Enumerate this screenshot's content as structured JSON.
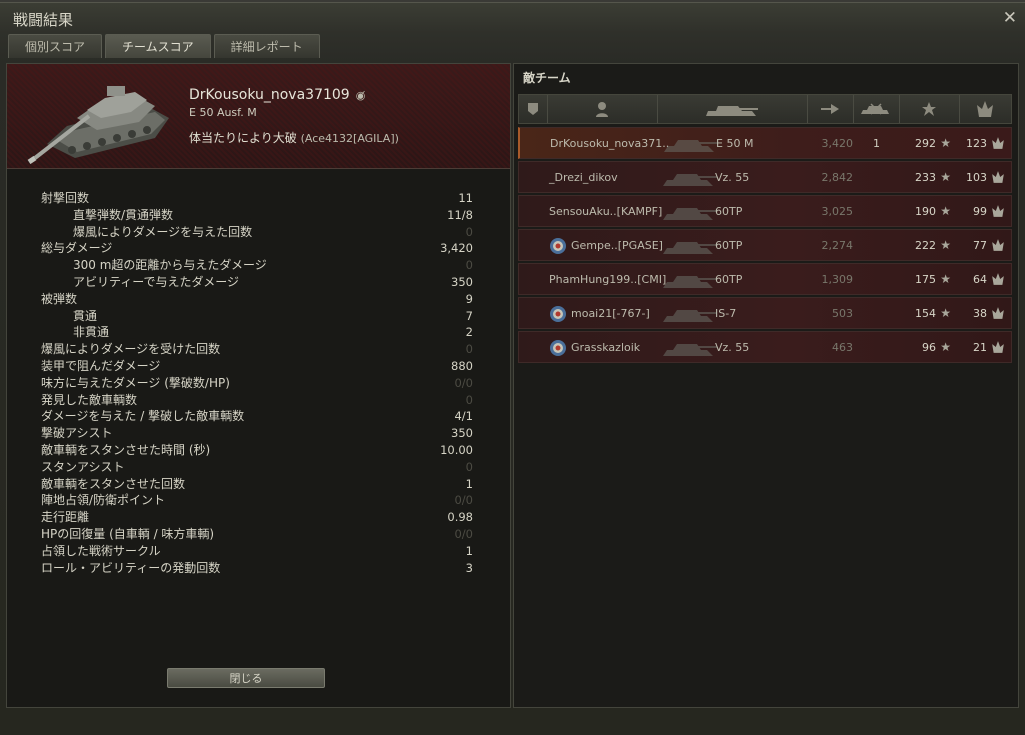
{
  "window": {
    "title": "戦闘結果"
  },
  "tabs": [
    {
      "label": "個別スコア",
      "active": false
    },
    {
      "label": "チームスコア",
      "active": true
    },
    {
      "label": "詳細レポート",
      "active": false
    }
  ],
  "player": {
    "name": "DrKousoku_nova37109",
    "tank": "E 50 Ausf. M",
    "status": "体当たりにより大破",
    "killer": "(Ace4132[AGILA])"
  },
  "stats": [
    {
      "label": "射撃回数",
      "value": "11",
      "indent": false,
      "zero": false
    },
    {
      "label": "直撃弾数/貫通弾数",
      "value": "11/8",
      "indent": true,
      "zero": false
    },
    {
      "label": "爆風によりダメージを与えた回数",
      "value": "0",
      "indent": true,
      "zero": true
    },
    {
      "label": "総与ダメージ",
      "value": "3,420",
      "indent": false,
      "zero": false
    },
    {
      "label": "300 m超の距離から与えたダメージ",
      "value": "0",
      "indent": true,
      "zero": true
    },
    {
      "label": "アビリティーで与えたダメージ",
      "value": "350",
      "indent": true,
      "zero": false
    },
    {
      "label": "被弾数",
      "value": "9",
      "indent": false,
      "zero": false
    },
    {
      "label": "貫通",
      "value": "7",
      "indent": true,
      "zero": false
    },
    {
      "label": "非貫通",
      "value": "2",
      "indent": true,
      "zero": false
    },
    {
      "label": "爆風によりダメージを受けた回数",
      "value": "0",
      "indent": false,
      "zero": true
    },
    {
      "label": "装甲で阻んだダメージ",
      "value": "880",
      "indent": false,
      "zero": false
    },
    {
      "label": "味方に与えたダメージ (撃破数/HP)",
      "value": "0/0",
      "indent": false,
      "zero": true
    },
    {
      "label": "発見した敵車輌数",
      "value": "0",
      "indent": false,
      "zero": true
    },
    {
      "label": "ダメージを与えた / 撃破した敵車輌数",
      "value": "4/1",
      "indent": false,
      "zero": false
    },
    {
      "label": "撃破アシスト",
      "value": "350",
      "indent": false,
      "zero": false
    },
    {
      "label": "敵車輌をスタンさせた時間 (秒)",
      "value": "10.00",
      "indent": false,
      "zero": false
    },
    {
      "label": "スタンアシスト",
      "value": "0",
      "indent": false,
      "zero": true
    },
    {
      "label": "敵車輌をスタンさせた回数",
      "value": "1",
      "indent": false,
      "zero": false
    },
    {
      "label": "陣地占領/防衛ポイント",
      "value": "0/0",
      "indent": false,
      "zero": true
    },
    {
      "label": "走行距離",
      "value": "0.98",
      "indent": false,
      "zero": false
    },
    {
      "label": "HPの回復量 (自車輌 / 味方車輌)",
      "value": "0/0",
      "indent": false,
      "zero": true
    },
    {
      "label": "占領した戦術サークル",
      "value": "1",
      "indent": false,
      "zero": false
    },
    {
      "label": "ロール・アビリティーの発動回数",
      "value": "3",
      "indent": false,
      "zero": false
    }
  ],
  "close_button": "閉じる",
  "team": {
    "title": "敵チーム",
    "rows": [
      {
        "name": "DrKousoku_nova371..",
        "tank": "E 50 M",
        "damage": "3,420",
        "kills": "1",
        "xp": "292",
        "points": "123",
        "clan": false,
        "self": true
      },
      {
        "name": "_Drezi_dikov",
        "tank": "Vz. 55",
        "damage": "2,842",
        "kills": "",
        "xp": "233",
        "points": "103",
        "clan": false,
        "self": false
      },
      {
        "name": "SensouAku..[KAMPF]",
        "tank": "60TP",
        "damage": "3,025",
        "kills": "",
        "xp": "190",
        "points": "99",
        "clan": false,
        "self": false
      },
      {
        "name": "Gempe..[PGASE]",
        "tank": "60TP",
        "damage": "2,274",
        "kills": "",
        "xp": "222",
        "points": "77",
        "clan": true,
        "self": false
      },
      {
        "name": "PhamHung199..[CMI]",
        "tank": "60TP",
        "damage": "1,309",
        "kills": "",
        "xp": "175",
        "points": "64",
        "clan": false,
        "self": false
      },
      {
        "name": "moai21[-767-]",
        "tank": "IS-7",
        "damage": "503",
        "kills": "",
        "xp": "154",
        "points": "38",
        "clan": true,
        "self": false
      },
      {
        "name": "Grasskazloik",
        "tank": "Vz. 55",
        "damage": "463",
        "kills": "",
        "xp": "96",
        "points": "21",
        "clan": true,
        "self": false
      }
    ]
  }
}
